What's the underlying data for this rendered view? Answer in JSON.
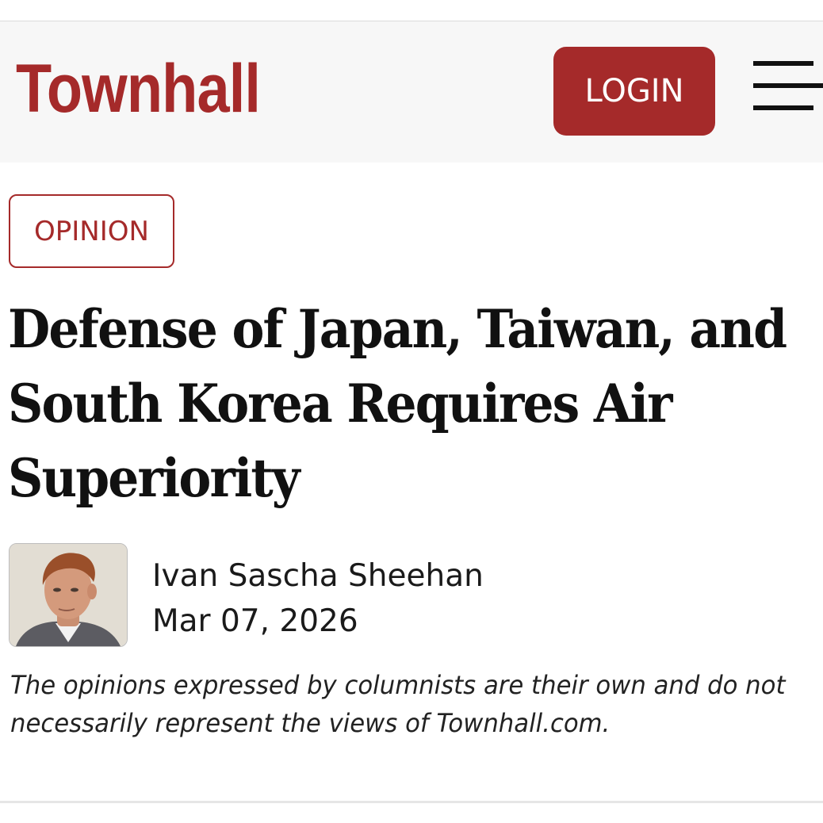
{
  "header": {
    "logo_text": "Townhall",
    "login_label": "LOGIN",
    "menu_icon": "hamburger-menu-icon"
  },
  "article": {
    "category": "OPINION",
    "headline": "Defense of Japan, Taiwan, and South Korea Requires Air Superiority",
    "author": {
      "name": "Ivan Sascha Sheehan",
      "avatar": "author-photo"
    },
    "date": "Mar 07, 2026",
    "disclaimer": "The opinions expressed by columnists are their own and do not necessarily represent the views of Townhall.com."
  },
  "colors": {
    "brand": "#a52a2a",
    "header_bg": "#f7f7f7",
    "text": "#111111"
  }
}
